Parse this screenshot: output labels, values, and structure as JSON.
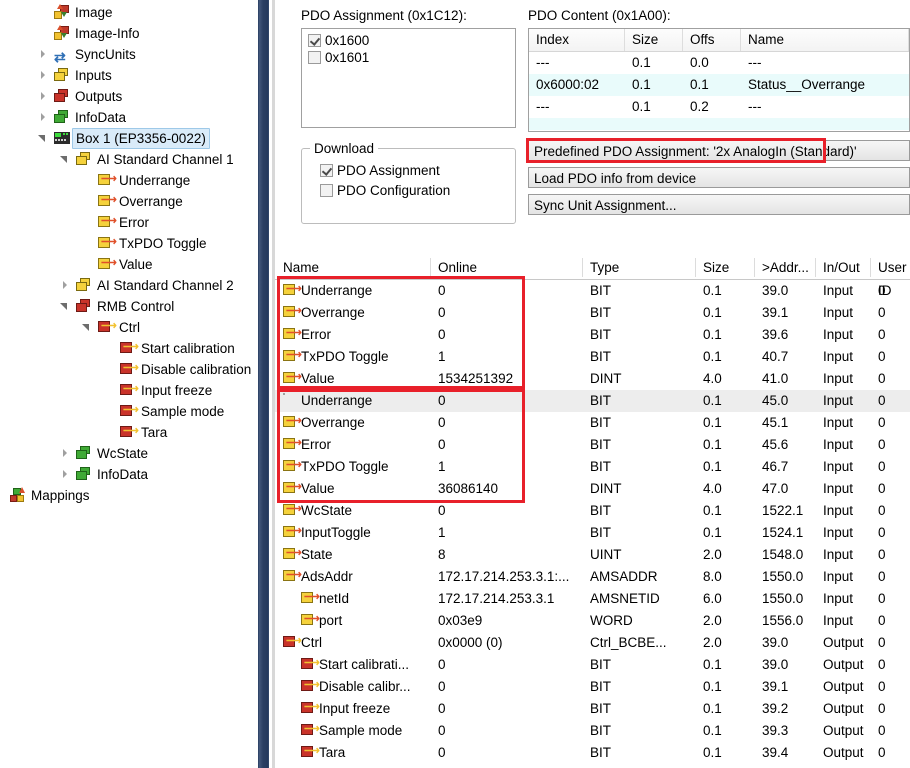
{
  "tree": {
    "items": [
      {
        "label": "Image",
        "icon": "image-icon",
        "depth": 2,
        "expander": "none",
        "selected": false
      },
      {
        "label": "Image-Info",
        "icon": "image-info-icon",
        "depth": 2,
        "expander": "none",
        "selected": false
      },
      {
        "label": "SyncUnits",
        "icon": "sync-units-icon",
        "depth": 2,
        "expander": "collapsed",
        "selected": false
      },
      {
        "label": "Inputs",
        "icon": "inputs-folder-icon",
        "depth": 2,
        "expander": "collapsed",
        "selected": false
      },
      {
        "label": "Outputs",
        "icon": "outputs-folder-icon",
        "depth": 2,
        "expander": "collapsed",
        "selected": false
      },
      {
        "label": "InfoData",
        "icon": "info-data-folder-icon",
        "depth": 2,
        "expander": "collapsed",
        "selected": false
      },
      {
        "label": "Box 1 (EP3356-0022)",
        "icon": "ethercat-box-icon",
        "depth": 2,
        "expander": "expanded",
        "selected": true
      },
      {
        "label": "AI Standard Channel 1",
        "icon": "inputs-folder-icon",
        "depth": 3,
        "expander": "expanded",
        "selected": false
      },
      {
        "label": "Underrange",
        "icon": "input-variable-icon",
        "depth": 4,
        "expander": "none",
        "selected": false
      },
      {
        "label": "Overrange",
        "icon": "input-variable-icon",
        "depth": 4,
        "expander": "none",
        "selected": false
      },
      {
        "label": "Error",
        "icon": "input-variable-icon",
        "depth": 4,
        "expander": "none",
        "selected": false
      },
      {
        "label": "TxPDO Toggle",
        "icon": "input-variable-icon",
        "depth": 4,
        "expander": "none",
        "selected": false
      },
      {
        "label": "Value",
        "icon": "input-variable-icon",
        "depth": 4,
        "expander": "none",
        "selected": false
      },
      {
        "label": "AI Standard Channel 2",
        "icon": "inputs-folder-icon",
        "depth": 3,
        "expander": "collapsed",
        "selected": false
      },
      {
        "label": "RMB Control",
        "icon": "outputs-folder-icon",
        "depth": 3,
        "expander": "expanded",
        "selected": false
      },
      {
        "label": "Ctrl",
        "icon": "output-variable-icon",
        "depth": 4,
        "expander": "expanded",
        "selected": false
      },
      {
        "label": "Start calibration",
        "icon": "output-variable-icon",
        "depth": 5,
        "expander": "none",
        "selected": false
      },
      {
        "label": "Disable calibration",
        "icon": "output-variable-icon",
        "depth": 5,
        "expander": "none",
        "selected": false
      },
      {
        "label": "Input freeze",
        "icon": "output-variable-icon",
        "depth": 5,
        "expander": "none",
        "selected": false
      },
      {
        "label": "Sample mode",
        "icon": "output-variable-icon",
        "depth": 5,
        "expander": "none",
        "selected": false
      },
      {
        "label": "Tara",
        "icon": "output-variable-icon",
        "depth": 5,
        "expander": "none",
        "selected": false
      },
      {
        "label": "WcState",
        "icon": "info-data-folder-icon",
        "depth": 3,
        "expander": "collapsed",
        "selected": false
      },
      {
        "label": "InfoData",
        "icon": "info-data-folder-icon",
        "depth": 3,
        "expander": "collapsed",
        "selected": false
      },
      {
        "label": "Mappings",
        "icon": "mappings-icon",
        "depth": 0,
        "expander": "none",
        "selected": false
      }
    ]
  },
  "pdo_assignment": {
    "title": "PDO Assignment (0x1C12):",
    "items": [
      {
        "label": "0x1600",
        "checked": true
      },
      {
        "label": "0x1601",
        "checked": false
      }
    ]
  },
  "download": {
    "title": "Download",
    "items": [
      {
        "label": "PDO Assignment",
        "checked": true
      },
      {
        "label": "PDO Configuration",
        "checked": false
      }
    ]
  },
  "pdo_content": {
    "title": "PDO Content (0x1A00):",
    "columns": [
      "Index",
      "Size",
      "Offs",
      "Name"
    ],
    "rows": [
      {
        "index": "---",
        "size": "0.1",
        "offs": "0.0",
        "name": "---",
        "highlight": false
      },
      {
        "index": "0x6000:02",
        "size": "0.1",
        "offs": "0.1",
        "name": "Status__Overrange",
        "highlight": true
      },
      {
        "index": "---",
        "size": "0.1",
        "offs": "0.2",
        "name": "---",
        "highlight": false
      }
    ]
  },
  "buttons": {
    "predefined_pdo": "Predefined PDO Assignment: '2x AnalogIn (Standard)'",
    "load_pdo": "Load PDO info from device",
    "sync_unit": "Sync Unit Assignment..."
  },
  "table": {
    "columns": [
      "Name",
      "Online",
      "Type",
      "Size",
      ">Addr...",
      "In/Out",
      "User ID"
    ],
    "rows": [
      {
        "name": "Underrange",
        "icon": "input-variable-icon",
        "indent": 0,
        "online": "0",
        "type": "BIT",
        "size": "0.1",
        "addr": "39.0",
        "inout": "Input",
        "userid": "0",
        "selected": false
      },
      {
        "name": "Overrange",
        "icon": "input-variable-icon",
        "indent": 0,
        "online": "0",
        "type": "BIT",
        "size": "0.1",
        "addr": "39.1",
        "inout": "Input",
        "userid": "0",
        "selected": false
      },
      {
        "name": "Error",
        "icon": "input-variable-icon",
        "indent": 0,
        "online": "0",
        "type": "BIT",
        "size": "0.1",
        "addr": "39.6",
        "inout": "Input",
        "userid": "0",
        "selected": false
      },
      {
        "name": "TxPDO Toggle",
        "icon": "input-variable-icon",
        "indent": 0,
        "online": "1",
        "type": "BIT",
        "size": "0.1",
        "addr": "40.7",
        "inout": "Input",
        "userid": "0",
        "selected": false
      },
      {
        "name": "Value",
        "icon": "input-variable-icon",
        "indent": 0,
        "online": "1534251392",
        "type": "DINT",
        "size": "4.0",
        "addr": "41.0",
        "inout": "Input",
        "userid": "0",
        "selected": false
      },
      {
        "name": "Underrange",
        "icon": "linked-variable-icon",
        "indent": 0,
        "online": "0",
        "type": "BIT",
        "size": "0.1",
        "addr": "45.0",
        "inout": "Input",
        "userid": "0",
        "selected": true
      },
      {
        "name": "Overrange",
        "icon": "input-variable-icon",
        "indent": 0,
        "online": "0",
        "type": "BIT",
        "size": "0.1",
        "addr": "45.1",
        "inout": "Input",
        "userid": "0",
        "selected": false
      },
      {
        "name": "Error",
        "icon": "input-variable-icon",
        "indent": 0,
        "online": "0",
        "type": "BIT",
        "size": "0.1",
        "addr": "45.6",
        "inout": "Input",
        "userid": "0",
        "selected": false
      },
      {
        "name": "TxPDO Toggle",
        "icon": "input-variable-icon",
        "indent": 0,
        "online": "1",
        "type": "BIT",
        "size": "0.1",
        "addr": "46.7",
        "inout": "Input",
        "userid": "0",
        "selected": false
      },
      {
        "name": "Value",
        "icon": "input-variable-icon",
        "indent": 0,
        "online": "36086140",
        "type": "DINT",
        "size": "4.0",
        "addr": "47.0",
        "inout": "Input",
        "userid": "0",
        "selected": false
      },
      {
        "name": "WcState",
        "icon": "input-variable-icon",
        "indent": 0,
        "online": "0",
        "type": "BIT",
        "size": "0.1",
        "addr": "1522.1",
        "inout": "Input",
        "userid": "0",
        "selected": false
      },
      {
        "name": "InputToggle",
        "icon": "input-variable-icon",
        "indent": 0,
        "online": "1",
        "type": "BIT",
        "size": "0.1",
        "addr": "1524.1",
        "inout": "Input",
        "userid": "0",
        "selected": false
      },
      {
        "name": "State",
        "icon": "input-variable-icon",
        "indent": 0,
        "online": "8",
        "type": "UINT",
        "size": "2.0",
        "addr": "1548.0",
        "inout": "Input",
        "userid": "0",
        "selected": false
      },
      {
        "name": "AdsAddr",
        "icon": "input-variable-icon",
        "indent": 0,
        "online": "172.17.214.253.3.1:...",
        "type": "AMSADDR",
        "size": "8.0",
        "addr": "1550.0",
        "inout": "Input",
        "userid": "0",
        "selected": false
      },
      {
        "name": "netId",
        "icon": "input-variable-icon",
        "indent": 1,
        "online": "172.17.214.253.3.1",
        "type": "AMSNETID",
        "size": "6.0",
        "addr": "1550.0",
        "inout": "Input",
        "userid": "0",
        "selected": false
      },
      {
        "name": "port",
        "icon": "input-variable-icon",
        "indent": 1,
        "online": "0x03e9",
        "type": "WORD",
        "size": "2.0",
        "addr": "1556.0",
        "inout": "Input",
        "userid": "0",
        "selected": false
      },
      {
        "name": "Ctrl",
        "icon": "output-variable-icon",
        "indent": 0,
        "online": "0x0000 (0)",
        "type": "Ctrl_BCBE...",
        "size": "2.0",
        "addr": "39.0",
        "inout": "Output",
        "userid": "0",
        "selected": false
      },
      {
        "name": "Start calibrati...",
        "icon": "output-variable-icon",
        "indent": 1,
        "online": "0",
        "type": "BIT",
        "size": "0.1",
        "addr": "39.0",
        "inout": "Output",
        "userid": "0",
        "selected": false
      },
      {
        "name": "Disable calibr...",
        "icon": "output-variable-icon",
        "indent": 1,
        "online": "0",
        "type": "BIT",
        "size": "0.1",
        "addr": "39.1",
        "inout": "Output",
        "userid": "0",
        "selected": false
      },
      {
        "name": "Input freeze",
        "icon": "output-variable-icon",
        "indent": 1,
        "online": "0",
        "type": "BIT",
        "size": "0.1",
        "addr": "39.2",
        "inout": "Output",
        "userid": "0",
        "selected": false
      },
      {
        "name": "Sample mode",
        "icon": "output-variable-icon",
        "indent": 1,
        "online": "0",
        "type": "BIT",
        "size": "0.1",
        "addr": "39.3",
        "inout": "Output",
        "userid": "0",
        "selected": false
      },
      {
        "name": "Tara",
        "icon": "output-variable-icon",
        "indent": 1,
        "online": "0",
        "type": "BIT",
        "size": "0.1",
        "addr": "39.4",
        "inout": "Output",
        "userid": "0",
        "selected": false
      }
    ]
  },
  "annotations": {
    "highlight_color": "#e8202a",
    "boxes": [
      {
        "name": "predefined-pdo-highlight"
      },
      {
        "name": "channel-1-rows-highlight"
      },
      {
        "name": "channel-2-rows-highlight"
      }
    ]
  }
}
